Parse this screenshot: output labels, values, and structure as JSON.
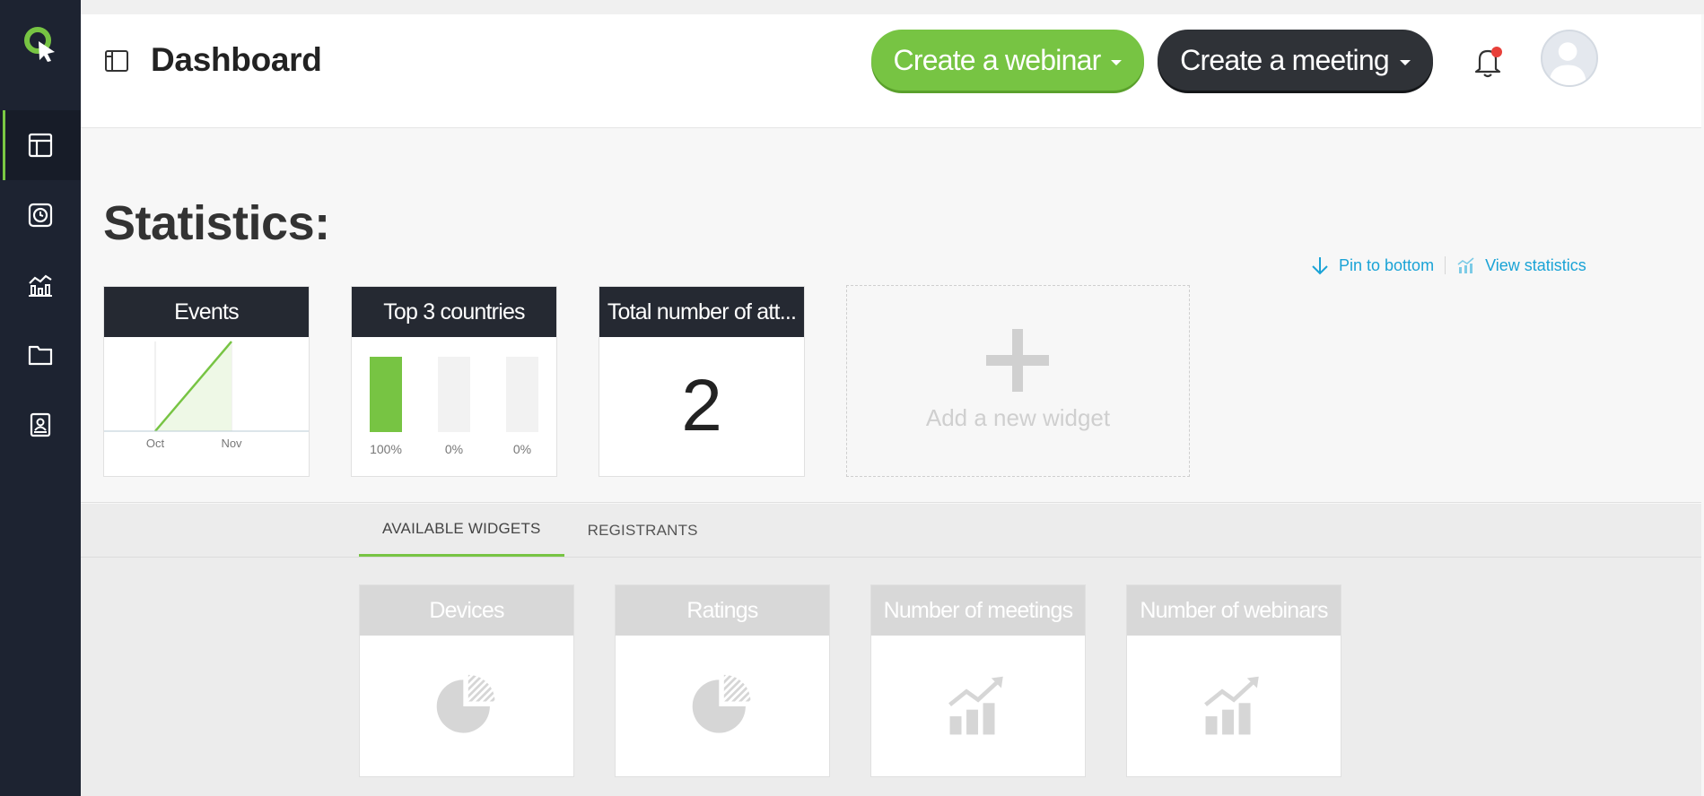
{
  "header": {
    "title": "Dashboard",
    "create_webinar_label": "Create a webinar",
    "create_meeting_label": "Create a meeting"
  },
  "sidebar": {
    "items": [
      {
        "name": "dashboard",
        "icon": "dashboard-icon",
        "active": true
      },
      {
        "name": "webinars",
        "icon": "clock-icon",
        "active": false
      },
      {
        "name": "statistics",
        "icon": "chart-icon",
        "active": false
      },
      {
        "name": "files",
        "icon": "folder-icon",
        "active": false
      },
      {
        "name": "contacts",
        "icon": "contacts-icon",
        "active": false
      }
    ]
  },
  "stats": {
    "title": "Statistics:",
    "pin_label": "Pin to bottom",
    "view_label": "View statistics",
    "widgets": {
      "events": {
        "title": "Events",
        "chart_data": {
          "type": "area",
          "x": [
            "Oct",
            "Nov"
          ],
          "series": [
            {
              "values": [
                0,
                1
              ]
            }
          ]
        }
      },
      "countries": {
        "title": "Top 3 countries",
        "chart_data": {
          "type": "bar",
          "categories": [
            "",
            "",
            ""
          ],
          "values": [
            100,
            0,
            0
          ],
          "labels": [
            "100%",
            "0%",
            "0%"
          ],
          "ylim": [
            0,
            100
          ]
        }
      },
      "attendees": {
        "title": "Total number of att...",
        "value": "2"
      }
    },
    "add_widget_label": "Add a new widget"
  },
  "tabs": [
    {
      "label": "AVAILABLE WIDGETS",
      "active": true
    },
    {
      "label": "REGISTRANTS",
      "active": false
    }
  ],
  "available_widgets": [
    {
      "title": "Devices",
      "icon": "pie-chart-icon"
    },
    {
      "title": "Ratings",
      "icon": "pie-chart-icon"
    },
    {
      "title": "Number of meetings",
      "icon": "growth-chart-icon"
    },
    {
      "title": "Number of webinars",
      "icon": "growth-chart-icon"
    }
  ],
  "colors": {
    "accent": "#77c443",
    "sidebar": "#1d2331",
    "link": "#1aa3d6",
    "dark_button": "#2f3237"
  }
}
